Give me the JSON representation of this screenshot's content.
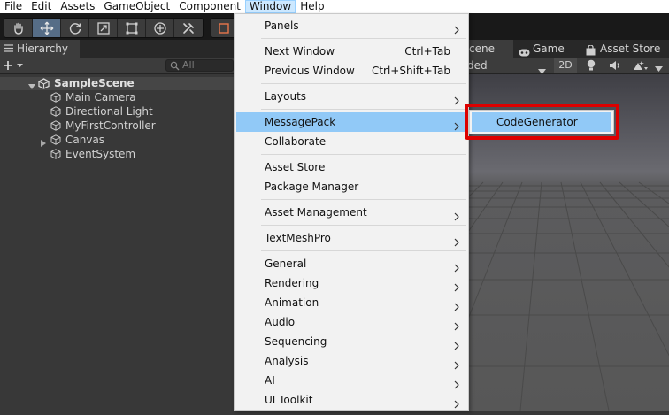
{
  "menubar": {
    "items": [
      "File",
      "Edit",
      "Assets",
      "GameObject",
      "Component",
      "Window",
      "Help"
    ],
    "active": "Window"
  },
  "toolbar": {
    "tools": [
      "hand-tool-icon",
      "move-tool-icon",
      "rotate-tool-icon",
      "scale-tool-icon",
      "rect-tool-icon",
      "transform-tool-icon",
      "custom-tool-icon"
    ],
    "active_tool": "move-tool-icon"
  },
  "hierarchy": {
    "tab_label": "Hierarchy",
    "search_placeholder": "All",
    "scene_name": "SampleScene",
    "objects": [
      "Main Camera",
      "Directional Light",
      "MyFirstController",
      "Canvas",
      "EventSystem"
    ]
  },
  "scene_view": {
    "tabs": [
      "cene",
      "Game",
      "Asset Store"
    ],
    "shading_mode_partial": "ded",
    "toggle_2d": "2D"
  },
  "window_menu": {
    "items": [
      {
        "label": "Panels",
        "submenu": true
      },
      {
        "separator": true
      },
      {
        "label": "Next Window",
        "shortcut": "Ctrl+Tab"
      },
      {
        "label": "Previous Window",
        "shortcut": "Ctrl+Shift+Tab"
      },
      {
        "separator": true
      },
      {
        "label": "Layouts",
        "submenu": true
      },
      {
        "separator": true
      },
      {
        "label": "MessagePack",
        "submenu": true,
        "highlighted": true
      },
      {
        "label": "Collaborate"
      },
      {
        "separator": true
      },
      {
        "label": "Asset Store"
      },
      {
        "label": "Package Manager"
      },
      {
        "separator": true
      },
      {
        "label": "Asset Management",
        "submenu": true
      },
      {
        "separator": true
      },
      {
        "label": "TextMeshPro",
        "submenu": true
      },
      {
        "separator": true
      },
      {
        "label": "General",
        "submenu": true
      },
      {
        "label": "Rendering",
        "submenu": true
      },
      {
        "label": "Animation",
        "submenu": true
      },
      {
        "label": "Audio",
        "submenu": true
      },
      {
        "label": "Sequencing",
        "submenu": true
      },
      {
        "label": "Analysis",
        "submenu": true
      },
      {
        "label": "AI",
        "submenu": true
      },
      {
        "label": "UI Toolkit",
        "submenu": true
      }
    ]
  },
  "messagepack_submenu": {
    "items": [
      "CodeGenerator"
    ]
  },
  "colors": {
    "highlight": "#91c9f7",
    "annotation_box": "#dd0000",
    "editor_dark": "#383838"
  }
}
